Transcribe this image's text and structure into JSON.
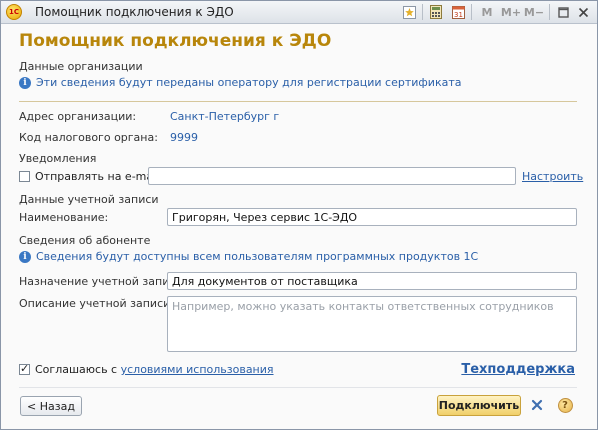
{
  "window": {
    "title": "Помощник подключения к ЭДО",
    "app_icon_text": "1С",
    "toolbar": {
      "mem_m": "M",
      "mem_mplus": "M+",
      "mem_mminus": "M−"
    }
  },
  "header": {
    "title": "Помощник подключения к ЭДО"
  },
  "organization": {
    "section_label": "Данные организации",
    "info_text": "Эти сведения будут переданы оператору для регистрации сертификата",
    "address_label": "Адрес организации:",
    "address_value": "Санкт-Петербург г",
    "tax_label": "Код налогового органа:",
    "tax_value": "9999"
  },
  "notifications": {
    "section_label": "Уведомления",
    "email_checkbox_label": "Отправлять на e-mail:",
    "email_checked": false,
    "email_value": "",
    "configure_link": "Настроить"
  },
  "account": {
    "section_label": "Данные учетной записи",
    "name_label": "Наименование:",
    "name_value": "Григорян, Через сервис 1С-ЭДО"
  },
  "subscriber": {
    "section_label": "Сведения об абоненте",
    "info_text": "Сведения будут доступны всем пользователям программных продуктов 1С",
    "purpose_label": "Назначение учетной записи:",
    "purpose_value": "Для документов от поставщика",
    "description_label": "Описание учетной записи:",
    "description_placeholder": "Например, можно указать контакты ответственных сотрудников"
  },
  "agreement": {
    "checked": true,
    "prefix": "Соглашаюсь с ",
    "link_text": "условиями использования"
  },
  "support_link": "Техподдержка",
  "footer": {
    "back_label": "< Назад",
    "connect_label": "Подключить",
    "help_glyph": "?"
  },
  "colors": {
    "title_accent": "#b8860b",
    "link_blue": "#2a5fa8",
    "primary_button": "#f0cf6a"
  }
}
